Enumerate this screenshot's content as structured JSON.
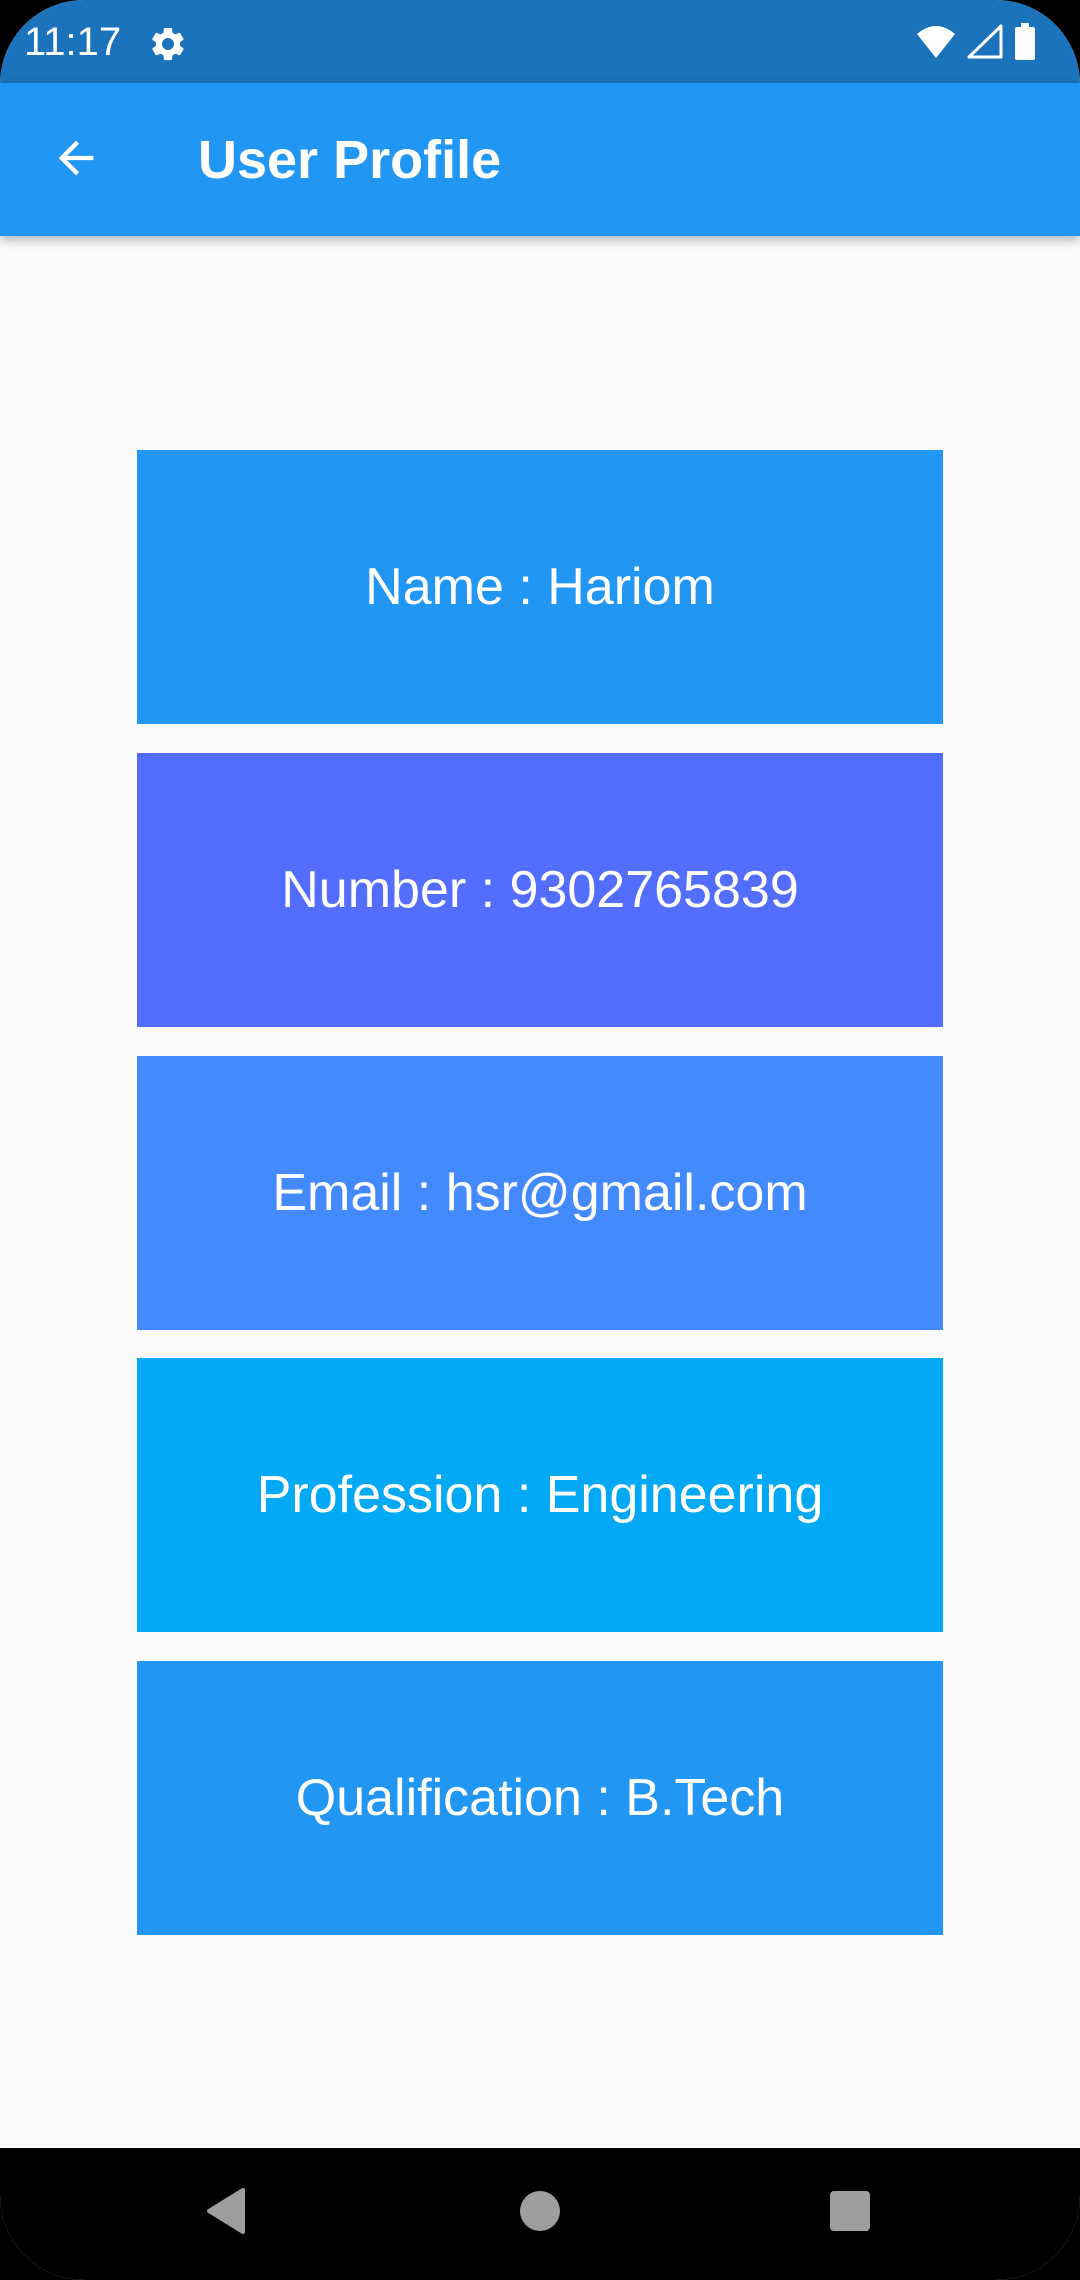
{
  "status_bar": {
    "time": "11:17",
    "icons": [
      "settings-icon",
      "wifi-icon",
      "cellular-signal-icon",
      "battery-icon"
    ]
  },
  "app_bar": {
    "back_icon": "arrow-back-icon",
    "title": "User Profile"
  },
  "cards": [
    {
      "text": "Name : Hariom",
      "color": "#2196F3"
    },
    {
      "text": "Number : 9302765839",
      "color": "#536DFE"
    },
    {
      "text": "Email : hsr@gmail.com",
      "color": "#448AFF"
    },
    {
      "text": "Profession : Engineering",
      "color": "#03A9F4"
    },
    {
      "text": "Qualification : B.Tech",
      "color": "#2196F3"
    }
  ],
  "nav_bar": {
    "icons": [
      "back-triangle-icon",
      "home-circle-icon",
      "recents-square-icon"
    ]
  },
  "colors": {
    "status_bar": "#1A73BB",
    "app_bar": "#2196F3",
    "background": "#FAFAFA",
    "nav_bar": "#000000"
  }
}
